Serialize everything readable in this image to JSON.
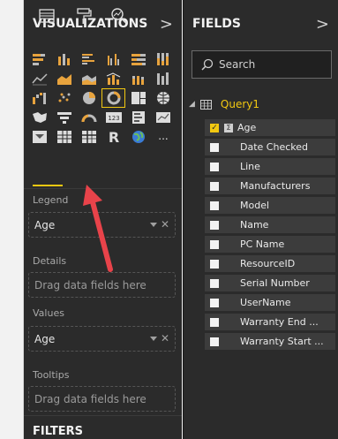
{
  "visualizations": {
    "title": "VISUALIZATIONS",
    "collapse": ">",
    "icons": [
      "stacked-bar-icon",
      "stacked-column-icon",
      "clustered-bar-icon",
      "clustered-column-icon",
      "100-bar-icon",
      "100-column-icon",
      "line-chart-icon",
      "area-chart-icon",
      "stacked-area-icon",
      "line-column-icon",
      "line-stacked-column-icon",
      "ribbon-chart-icon",
      "waterfall-icon",
      "scatter-icon",
      "pie-chart-icon",
      "donut-chart-icon",
      "treemap-icon",
      "map-icon",
      "filled-map-icon",
      "funnel-icon",
      "gauge-icon",
      "card-icon",
      "multirow-card-icon",
      "kpi-icon",
      "slicer-icon",
      "table-icon",
      "matrix-icon",
      "r-visual-icon",
      "globe-icon",
      "more-icon"
    ],
    "r_label": "R",
    "card_label": "123",
    "more_label": "..."
  },
  "wells": {
    "legend_label": "Legend",
    "legend_value": "Age",
    "details_label": "Details",
    "details_placeholder": "Drag data fields here",
    "values_label": "Values",
    "values_value": "Age",
    "tooltips_label": "Tooltips",
    "tooltips_placeholder": "Drag data fields here",
    "remove_glyph": "✕"
  },
  "filters": {
    "title": "FILTERS"
  },
  "fields": {
    "title": "FIELDS",
    "collapse": ">",
    "search_placeholder": "Search",
    "table_name": "Query1",
    "items": [
      {
        "label": "Age",
        "checked": true
      },
      {
        "label": "Date Checked",
        "checked": false
      },
      {
        "label": "Line",
        "checked": false
      },
      {
        "label": "Manufacturers",
        "checked": false
      },
      {
        "label": "Model",
        "checked": false
      },
      {
        "label": "Name",
        "checked": false
      },
      {
        "label": "PC Name",
        "checked": false
      },
      {
        "label": "ResourceID",
        "checked": false
      },
      {
        "label": "Serial Number",
        "checked": false
      },
      {
        "label": "UserName",
        "checked": false
      },
      {
        "label": "Warranty End ...",
        "checked": false
      },
      {
        "label": "Warranty Start ...",
        "checked": false
      }
    ],
    "sigma": "Σ"
  },
  "colors": {
    "pane_bg": "#2b2b2b",
    "accent": "#f2c811",
    "annotation_arrow": "#e8434a"
  }
}
